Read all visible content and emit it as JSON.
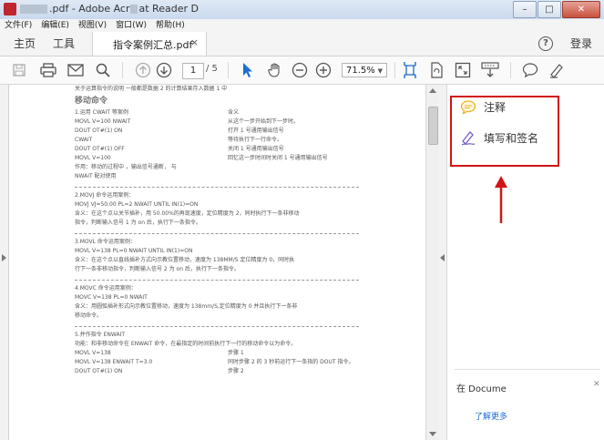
{
  "window": {
    "title": "…pdf - Adobe Acrobat Reader DC",
    "title_prefix": ".pdf - Adob",
    "title_mid": "Acr",
    "title_suffix": "at Reader D"
  },
  "menu": [
    "文件(F)",
    "编辑(E)",
    "视图(V)",
    "窗口(W)",
    "帮助(H)"
  ],
  "nav": {
    "home": "主页",
    "tools": "工具",
    "login": "登录",
    "help": "?"
  },
  "tab": {
    "label": "指令案例汇总.pdf",
    "close": "×"
  },
  "toolbar": {
    "page_current": "1",
    "page_total": "/ 5",
    "zoom": "71.5%",
    "zoom_caret": "▼"
  },
  "right_panel": {
    "items": [
      {
        "label": "注释",
        "icon": "comment-icon",
        "color": "#e8b429"
      },
      {
        "label": "填写和签名",
        "icon": "sign-icon",
        "color": "#7a5fc5"
      }
    ],
    "promo_text": "在 Docume",
    "promo_link": "了解更多"
  },
  "document": {
    "intro": "关于运算指令的说明 一般都是数据 2 的计算结果存入数据 1 中",
    "heading": "移动命令",
    "section1": {
      "title": "1.运用 CWAIT 等案例",
      "col_right_title": "含义",
      "rows": [
        [
          "MOVL V=100 NWAIT",
          "从这个一步开始到下一步时。"
        ],
        [
          "DOUT OT#(1) ON",
          "打开 1 号通用输出信号"
        ],
        [
          "CWAIT",
          "等待执行下一行命令。"
        ],
        [
          "DOUT OT#(1) OFF",
          "关闭 1 号通用输出信号"
        ],
        [
          "MOVL V=100",
          "回忆这一步时间时关闭 1 号通用输出信号"
        ]
      ],
      "note1": "作用：移动的过程中 ，输出信号通断，  与",
      "note2": "NWAIT 配对使用"
    },
    "section2": {
      "title": "2.MOVJ 命令运用案例：",
      "cmd": "MOVJ    VJ=50.00   PL=2    NWAIT    UNTIL     IN(1)=ON",
      "desc1": "含义：在这个点以关节插补，用 50.00%的再现速度，定位精度为 2，同时执行下一条非移动",
      "desc2": "指令，判断输入信号 1 为 on 后，执行下一条指令。"
    },
    "section3": {
      "title": "3.MOVL 命令运用案例：",
      "cmd": "MOVL     V=138     PL=0      NWAIT     UNTIL     IN(1)=ON",
      "desc1": "含义：在这个点以直线插补方式向示教位置移动，速度为 138MM/S 定位精度为 0，同时执",
      "desc2": "行下一条非移动指令，判断输入信号 2 为 on 后，执行下一条指令。"
    },
    "section4": {
      "title": "4.MOVC 命令运用案例：",
      "cmd": "MOVC      V=138        PL=0       NWAIT",
      "desc1": "含义：用圆弧插补形式向示教位置移动，速度为 138mm/S,定位精度为 0 并且执行下一条非",
      "desc2": "移动命令。"
    },
    "section5": {
      "title": "5.并作指令 ENWAIT",
      "desc": "功能：和非移动命令在 ENWAIT 命令，在最指定的时间前执行下一行的移动命令以为命令。",
      "rows": [
        [
          "MOVL V=138",
          "步骤 1"
        ],
        [
          "MOVL V=138 ENWAIT T=3.0",
          "同时步骤 2 的 3 秒前运行下一条指的 DOUT 指令。"
        ],
        [
          "DOUT OT#(1) ON",
          "步骤 2"
        ]
      ]
    }
  },
  "colors": {
    "accent": "#1f6fd0",
    "highlight_border": "#d21414"
  }
}
